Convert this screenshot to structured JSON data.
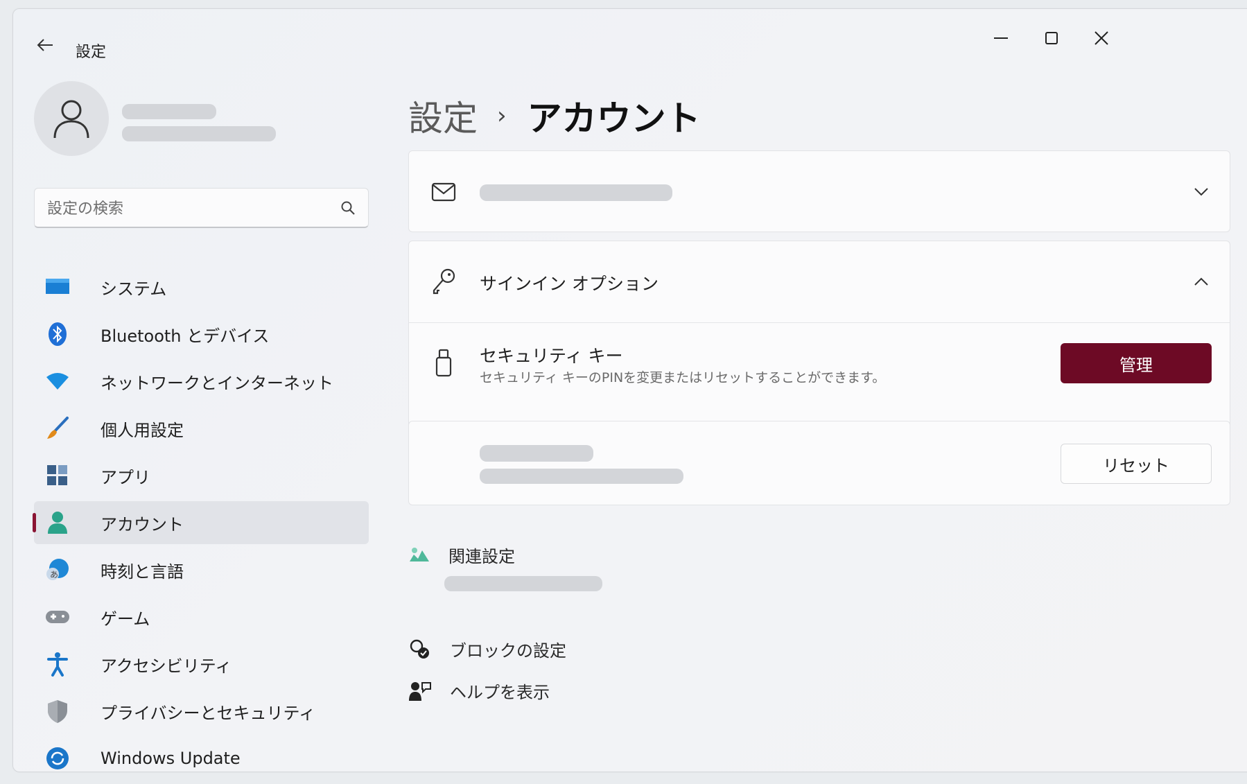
{
  "window": {
    "title": "設定",
    "controls": [
      "minimize-icon",
      "maximize-icon",
      "close-icon"
    ]
  },
  "sidebar": {
    "search": {
      "placeholder": "設定の検索"
    },
    "items": [
      {
        "label": "システム",
        "icon": "system-icon",
        "color": "#1a7fd4"
      },
      {
        "label": "Bluetooth とデバイス",
        "icon": "bluetooth-icon",
        "color": "#1f6fd6"
      },
      {
        "label": "ネットワークとインターネット",
        "icon": "wifi-icon",
        "color": "#1a8fe0"
      },
      {
        "label": "個人用設定",
        "icon": "brush-icon",
        "color": "#e08a1a"
      },
      {
        "label": "アプリ",
        "icon": "apps-icon",
        "color": "#3a5f88"
      },
      {
        "label": "アカウント",
        "icon": "account-icon",
        "color": "#2aa38a",
        "selected": true
      },
      {
        "label": "時刻と言語",
        "icon": "time-language-icon",
        "color": "#1f88d6"
      },
      {
        "label": "ゲーム",
        "icon": "gamepad-icon",
        "color": "#8a8f96"
      },
      {
        "label": "アクセシビリティ",
        "icon": "accessibility-icon",
        "color": "#1a76c9"
      },
      {
        "label": "プライバシーとセキュリティ",
        "icon": "shield-icon",
        "color": "#8a8f96"
      },
      {
        "label": "Windows Update",
        "icon": "windows-update-icon",
        "color": "#1a76c9"
      }
    ]
  },
  "main": {
    "breadcrumb": {
      "parent": "設定",
      "separator": "›",
      "current": "アカウント"
    },
    "signin_section": {
      "title": "サインイン オプション"
    },
    "security_key": {
      "title": "セキュリティ キー",
      "description": "セキュリティ キーのPINを変更またはリセットすることができます。",
      "button": "管理"
    },
    "reset_row": {
      "button": "リセット"
    },
    "related": {
      "title": "関連設定"
    },
    "links": [
      {
        "label": "ブロックの設定",
        "icon": "block-settings-icon"
      },
      {
        "label": "ヘルプを表示",
        "icon": "help-icon"
      }
    ]
  },
  "accent": "#6d0a25"
}
